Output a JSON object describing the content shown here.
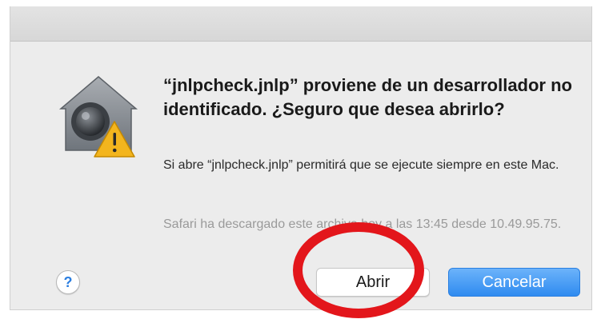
{
  "dialog": {
    "title": "“jnlpcheck.jnlp” proviene de un desarrollador no identificado. ¿Seguro que desea abrirlo?",
    "message": "Si abre “jnlpcheck.jnlp” permitirá que se ejecute siempre en este Mac.",
    "source_info": "Safari ha descargado este archivo hoy a las 13:45 desde 10.49.95.75.",
    "icon": "gatekeeper-warning-icon"
  },
  "buttons": {
    "help_label": "?",
    "open_label": "Abrir",
    "cancel_label": "Cancelar"
  },
  "annotation": {
    "shape": "circle-highlight-around-open-button",
    "color": "#e3161b"
  },
  "colors": {
    "default_button": "#2f8bf0",
    "warning": "#f3b51e",
    "dialog_background": "#ececec"
  }
}
